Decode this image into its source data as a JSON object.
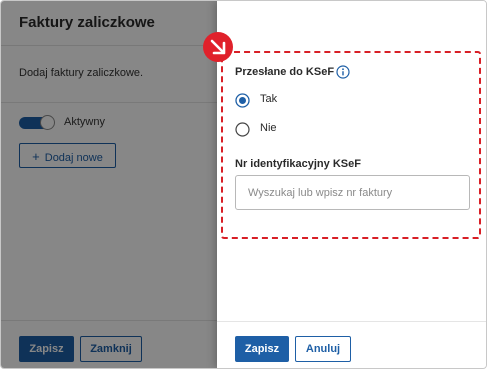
{
  "dialog": {
    "title": "Faktury zaliczkowe",
    "close_icon": "close-icon"
  },
  "background_panel": {
    "description": "Dodaj faktury zaliczkowe.",
    "toggle_label": "Aktywny",
    "toggle_on": true,
    "add_button_label": "Dodaj nowe",
    "add_icon": "plus-icon",
    "save_label": "Zapisz",
    "close_label": "Zamknij"
  },
  "drawer": {
    "ksef_sent": {
      "title": "Przesłane do KSeF",
      "info_icon": "info-icon",
      "options": [
        {
          "label": "Tak",
          "selected": true
        },
        {
          "label": "Nie",
          "selected": false
        }
      ]
    },
    "ksef_id": {
      "title": "Nr identyfikacyjny KSeF",
      "placeholder": "Wyszukaj lub wpisz nr faktury",
      "value": ""
    },
    "save_label": "Zapisz",
    "cancel_label": "Anuluj"
  },
  "annotation": {
    "badge_icon": "arrow-down-right-icon",
    "highlight_color": "#d81f26"
  },
  "colors": {
    "primary": "#1e5fa6",
    "accent_red": "#e0212b"
  }
}
